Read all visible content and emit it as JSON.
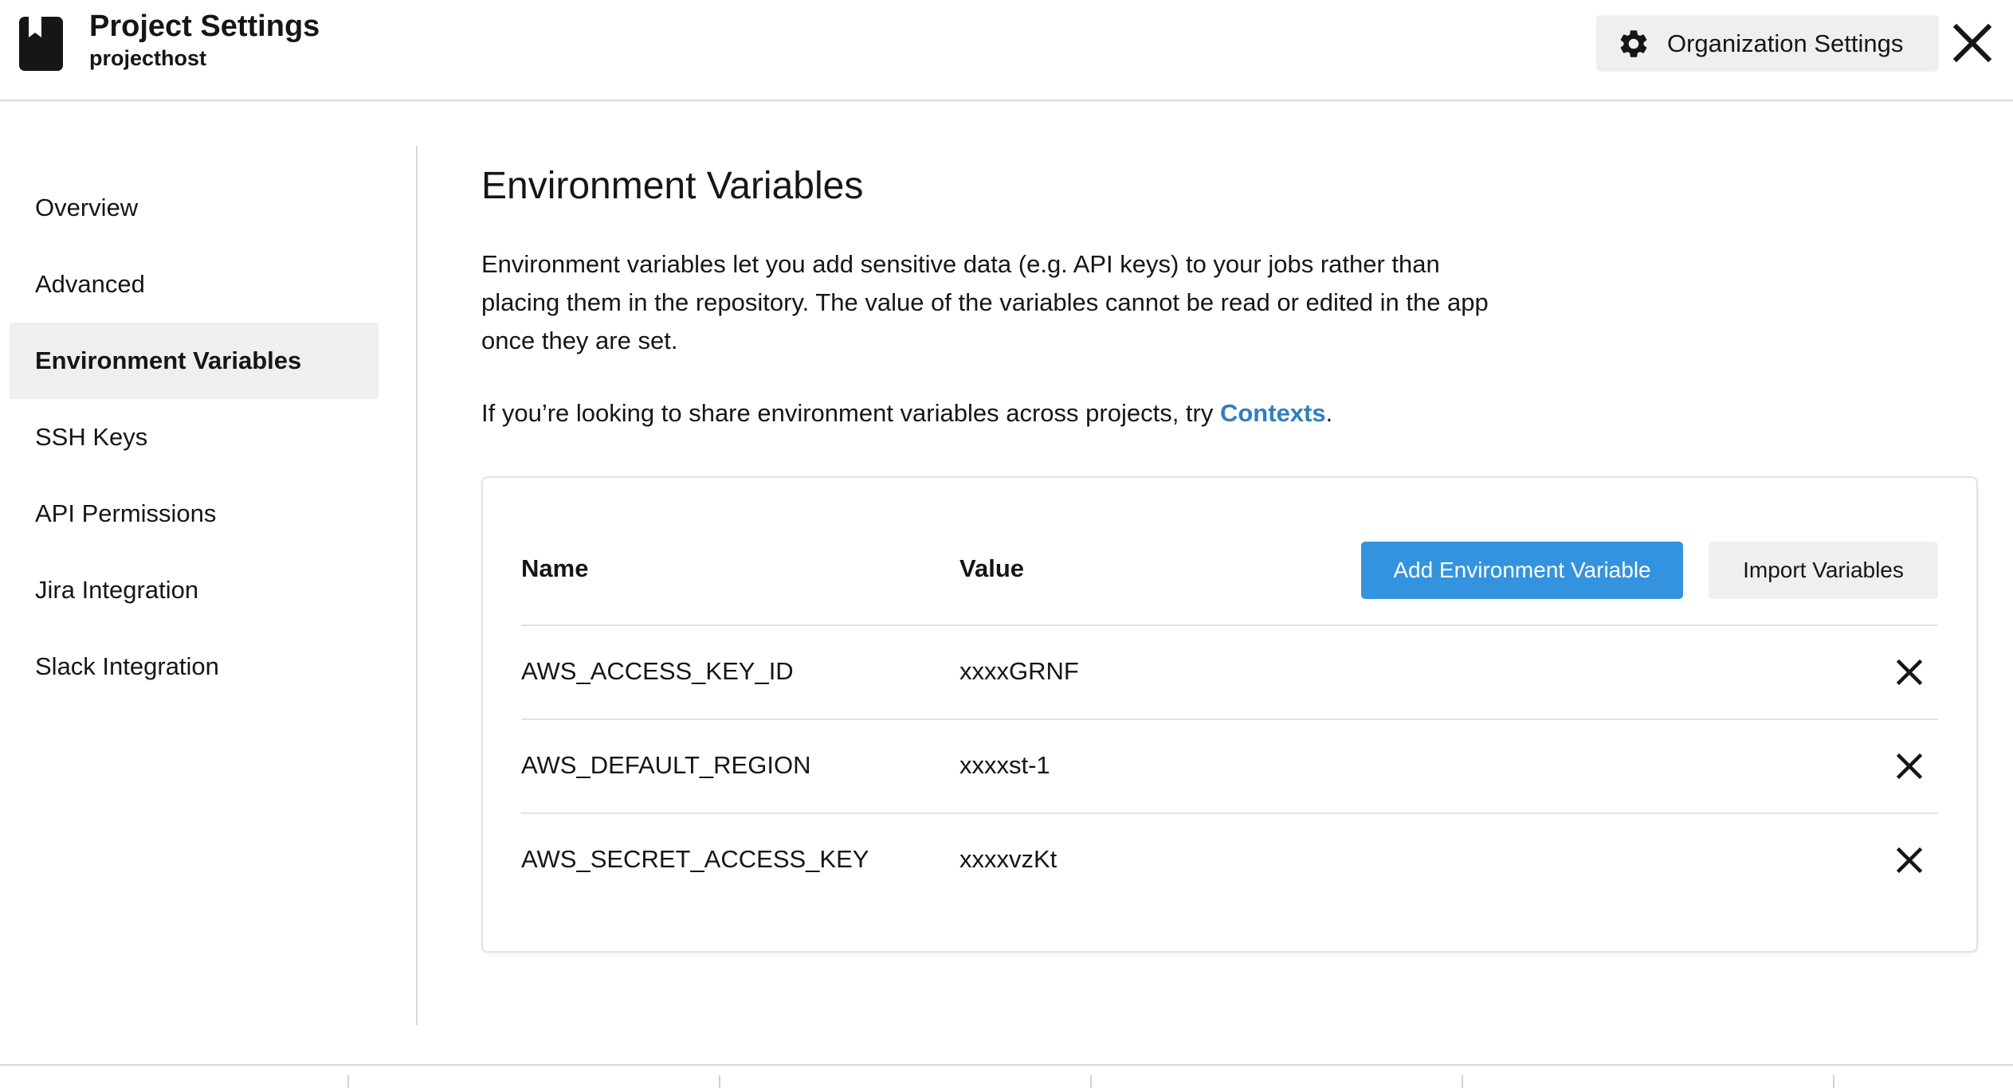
{
  "header": {
    "title": "Project Settings",
    "subtitle": "projecthost",
    "org_settings_label": "Organization Settings",
    "icons": {
      "project": "bookmark-icon",
      "org": "gear-icon",
      "close": "close-icon"
    }
  },
  "sidebar": {
    "items": [
      {
        "label": "Overview",
        "active": false
      },
      {
        "label": "Advanced",
        "active": false
      },
      {
        "label": "Environment Variables",
        "active": true
      },
      {
        "label": "SSH Keys",
        "active": false
      },
      {
        "label": "API Permissions",
        "active": false
      },
      {
        "label": "Jira Integration",
        "active": false
      },
      {
        "label": "Slack Integration",
        "active": false
      }
    ]
  },
  "main": {
    "title": "Environment Variables",
    "description": "Environment variables let you add sensitive data (e.g. API keys) to your jobs rather than placing them in the repository. The value of the variables cannot be read or edited in the app once they are set.",
    "share_prefix": "If you’re looking to share environment variables across projects, try ",
    "share_link": "Contexts",
    "share_suffix": ".",
    "table": {
      "headers": {
        "name": "Name",
        "value": "Value"
      },
      "add_button": "Add Environment Variable",
      "import_button": "Import Variables",
      "rows": [
        {
          "name": "AWS_ACCESS_KEY_ID",
          "value": "xxxxGRNF"
        },
        {
          "name": "AWS_DEFAULT_REGION",
          "value": "xxxxst-1"
        },
        {
          "name": "AWS_SECRET_ACCESS_KEY",
          "value": "xxxxvzKt"
        }
      ]
    }
  },
  "colors": {
    "accent": "#3493de",
    "link": "#2f7fc0",
    "active_bg": "#efefef",
    "text": "#161616"
  }
}
